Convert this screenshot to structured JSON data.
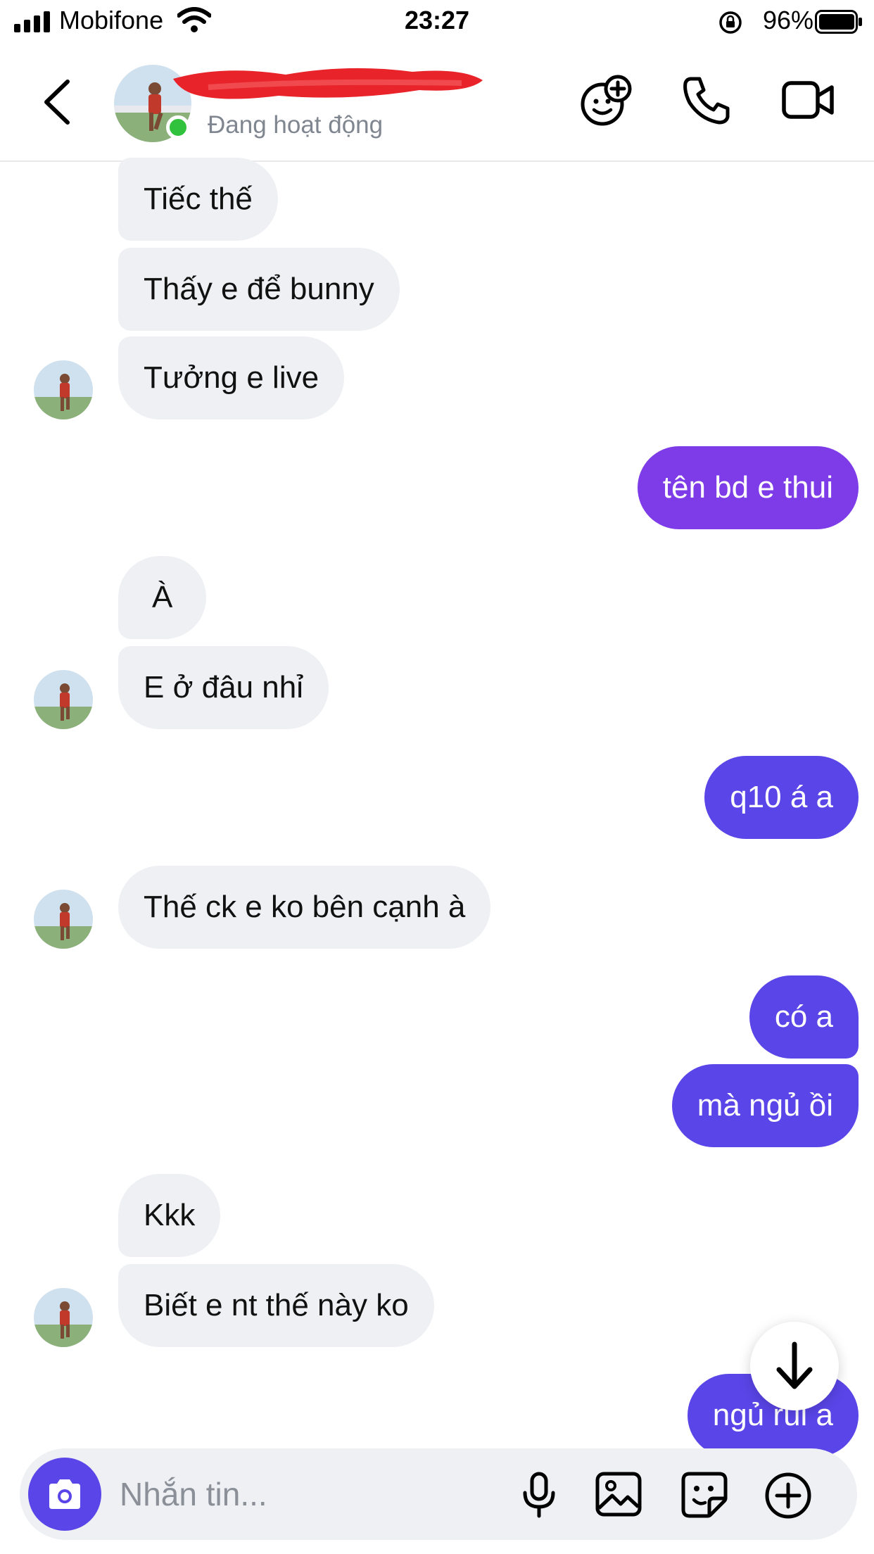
{
  "status_bar": {
    "carrier": "Mobifone",
    "time": "23:27",
    "battery": "96%"
  },
  "header": {
    "status": "Đang hoạt động"
  },
  "messages": [
    {
      "side": "in",
      "text": "Tiếc thế"
    },
    {
      "side": "in",
      "text": "Thấy e để bunny"
    },
    {
      "side": "in",
      "text": "Tưởng e live"
    },
    {
      "side": "out",
      "text": "tên bd e thui"
    },
    {
      "side": "in",
      "text": "À"
    },
    {
      "side": "in",
      "text": "E ở đâu nhỉ"
    },
    {
      "side": "out",
      "text": "q10 á a"
    },
    {
      "side": "in",
      "text": "Thế ck e ko bên cạnh à"
    },
    {
      "side": "out",
      "text": "có a"
    },
    {
      "side": "out",
      "text": "mà ngủ ồi"
    },
    {
      "side": "in",
      "text": "Kkk"
    },
    {
      "side": "in",
      "text": "Biết e nt thế này ko"
    },
    {
      "side": "out",
      "text": "ngủ rùi a"
    }
  ],
  "composer": {
    "placeholder": "Nhắn tin..."
  },
  "colors": {
    "outgoing_purple": "#7e3be8",
    "outgoing_blue": "#5a45e8",
    "incoming_bg": "#eef0f3",
    "online": "#31c23d"
  },
  "icons": [
    "back-chevron-icon",
    "add-effect-icon",
    "phone-icon",
    "video-call-icon",
    "arrow-down-icon",
    "camera-icon",
    "microphone-icon",
    "image-icon",
    "sticker-icon",
    "plus-circle-icon"
  ]
}
